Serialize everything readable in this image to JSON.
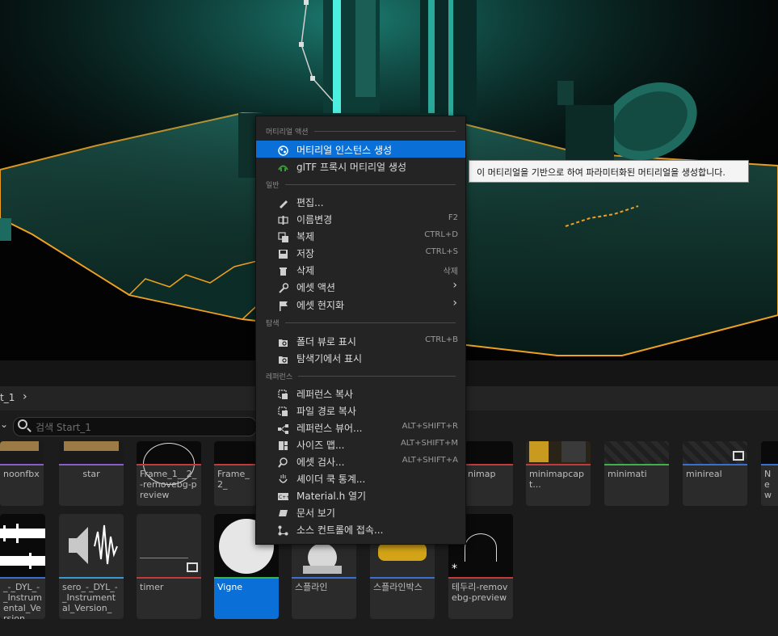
{
  "menu": {
    "sections": {
      "material_actions": "머티리얼 액션",
      "general": "일반",
      "explore": "탐색",
      "references": "레퍼런스"
    },
    "items": {
      "create_instance": "머티리얼 인스턴스 생성",
      "gltf_proxy": "glTF 프록시 머티리얼 생성",
      "edit": "편집...",
      "rename": "이름변경",
      "duplicate": "복제",
      "save": "저장",
      "delete": "삭제",
      "asset_actions": "에셋 액션",
      "asset_localization": "에셋 현지화",
      "show_in_folder": "폴더 뷰로 표시",
      "show_in_explorer": "탐색기에서 표시",
      "copy_reference": "레퍼런스 복사",
      "copy_file_path": "파일 경로 복사",
      "reference_viewer": "레퍼런스 뷰어...",
      "size_map": "사이즈 맵...",
      "audit_asset": "에셋 검사...",
      "shader_cook_stats": "셰이더 쿡 통계...",
      "open_material_h": "Material.h 열기",
      "view_docs": "문서 보기",
      "connect_source_control": "소스 컨트롤에 접속..."
    },
    "shortcuts": {
      "rename": "F2",
      "duplicate": "CTRL+D",
      "save": "CTRL+S",
      "delete": "삭제",
      "show_in_folder": "CTRL+B",
      "reference_viewer": "ALT+SHIFT+R",
      "size_map": "ALT+SHIFT+M",
      "audit_asset": "ALT+SHIFT+A"
    }
  },
  "tooltip": "이 머티리얼을 기반으로 하여 파라미터화된 머티리얼을 생성합니다.",
  "content_browser": {
    "breadcrumb": "t_1",
    "search_placeholder": "검색 Start_1",
    "row1": [
      {
        "label": "noonfbx",
        "color": "#8a5cc8"
      },
      {
        "label": "star",
        "color": "#8a5cc8"
      },
      {
        "label": "Frame_1__2_-removebg-preview",
        "color": "#c23b3b"
      },
      {
        "label": "Frame_2_",
        "color": "#c23b3b"
      },
      {
        "label": "nimap",
        "color": "#c23b3b"
      },
      {
        "label": "minimapcapt...",
        "color": "#c23b3b"
      },
      {
        "label": "minimati",
        "color": "#3fb04a"
      },
      {
        "label": "minireal",
        "color": "#3a6fd0"
      },
      {
        "label": "New",
        "color": "#3a6fd0"
      }
    ],
    "row2": [
      {
        "label": "_-_DYL_-_Instrumental_Version__...",
        "color": "#3a6fd0"
      },
      {
        "label": "sero_-_DYL_-_Instrumental_Version__...",
        "color": "#3a9ad0"
      },
      {
        "label": "timer",
        "color": "#c23b3b"
      },
      {
        "label": "Vigne",
        "color": "#3fb04a"
      },
      {
        "label": "스플라인",
        "color": "#3a6fd0"
      },
      {
        "label": "스플라인박스",
        "color": "#3a6fd0"
      },
      {
        "label": "테두리-removebg-preview",
        "color": "#c23b3b"
      }
    ]
  },
  "colors": {
    "accent": "#0a6fd6",
    "selection_outline": "#f0a020",
    "teal": "#16c4b4"
  }
}
